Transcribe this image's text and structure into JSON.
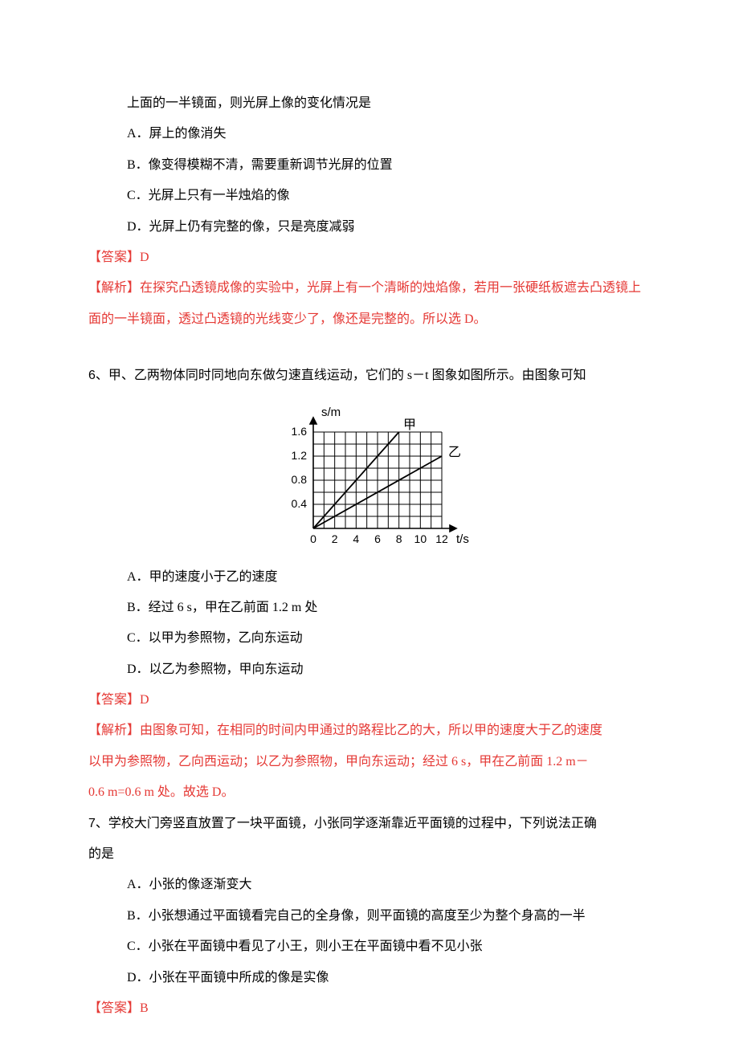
{
  "q5": {
    "stem_tail": "上面的一半镜面，则光屏上像的变化情况是",
    "optionA": "A．屏上的像消失",
    "optionB": "B．像变得模糊不清，需要重新调节光屏的位置",
    "optionC": "C．光屏上只有一半烛焰的像",
    "optionD": "D．光屏上仍有完整的像，只是亮度减弱",
    "answer_label": "【答案】",
    "answer_value": "D",
    "analysis_label": "【解析】",
    "analysis_text": "在探究凸透镜成像的实验中，光屏上有一个清晰的烛焰像，若用一张硬纸板遮去凸透镜上面的一半镜面，透过凸透镜的光线变少了，像还是完整的。所以选 D。"
  },
  "q6": {
    "number": "6、",
    "stem": "甲、乙两物体同时同地向东做匀速直线运动，它们的 s－t 图象如图所示。由图象可知",
    "optionA": "A．甲的速度小于乙的速度",
    "optionB": "B．经过 6 s，甲在乙前面 1.2 m 处",
    "optionC": "C．以甲为参照物，乙向东运动",
    "optionD": "D．以乙为参照物，甲向东运动",
    "answer_label": "【答案】",
    "answer_value": "D",
    "analysis_label": "【解析】",
    "analysis_text1": "由图象可知，在相同的时间内甲通过的路程比乙的大，所以甲的速度大于乙的速度",
    "analysis_text2": "以甲为参照物，乙向西运动；以乙为参照物，甲向东运动；经过 6 s，甲在乙前面 1.2 m－",
    "analysis_text3": "0.6 m=0.6 m 处。故选 D。"
  },
  "q7": {
    "number": "7、",
    "stem1": "学校大门旁竖直放置了一块平面镜，小张同学逐渐靠近平面镜的过程中，下列说法正确",
    "stem2": "的是",
    "optionA": "A．小张的像逐渐变大",
    "optionB": "B．小张想通过平面镜看完自己的全身像，则平面镜的高度至少为整个身高的一半",
    "optionC": "C．小张在平面镜中看见了小王，则小王在平面镜中看不见小张",
    "optionD": "D．小张在平面镜中所成的像是实像",
    "answer_label": "【答案】",
    "answer_value": "B"
  },
  "chart_data": {
    "type": "line",
    "title": "",
    "xlabel": "t/s",
    "ylabel": "s/m",
    "x_ticks": [
      0,
      2,
      4,
      6,
      8,
      10,
      12
    ],
    "y_ticks": [
      0,
      0.4,
      0.8,
      1.2,
      1.6
    ],
    "xlim": [
      0,
      12
    ],
    "ylim": [
      0,
      1.6
    ],
    "series": [
      {
        "name": "甲",
        "points": [
          [
            0,
            0
          ],
          [
            8,
            1.6
          ]
        ]
      },
      {
        "name": "乙",
        "points": [
          [
            0,
            0
          ],
          [
            12,
            1.2
          ]
        ]
      }
    ],
    "annotations": [
      {
        "text": "甲",
        "near": [
          8,
          1.6
        ]
      },
      {
        "text": "乙",
        "near": [
          12,
          1.2
        ]
      }
    ]
  }
}
